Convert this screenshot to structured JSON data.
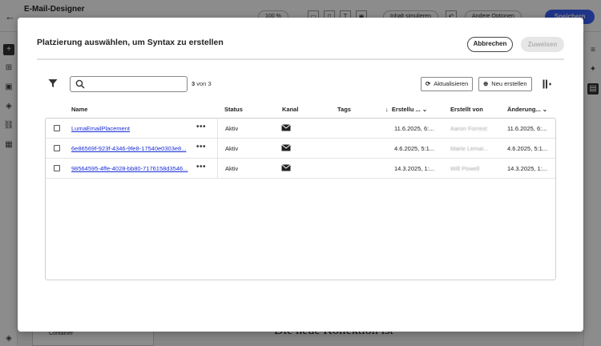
{
  "app": {
    "title": "E-Mail-Designer",
    "zoom": "100 %",
    "simulate": "Inhalt simulieren",
    "other_options": "Andere Optionen",
    "save": "Speichern",
    "canvas_text": "Die neue Kollektion ist",
    "container_label": "Container"
  },
  "modal": {
    "title": "Platzierung auswählen, um Syntax zu erstellen",
    "cancel": "Abbrechen",
    "assign": "Zuweisen",
    "search": {
      "value": "",
      "placeholder": ""
    },
    "count_current": "3",
    "count_suffix": "von 3",
    "refresh": "Aktualisieren",
    "create_new": "Neu erstellen",
    "columns": {
      "name": "Name",
      "status": "Status",
      "channel": "Kanal",
      "tags": "Tags",
      "created": "Erstellu ...",
      "created_by": "Erstellt von",
      "modified": "Änderung..."
    },
    "rows": [
      {
        "name": "LumaEmailPlacement",
        "status": "Aktiv",
        "created": "11.6.2025, 6:...",
        "created_by": "Aaron Forrest",
        "modified": "11.6.2025, 6:..."
      },
      {
        "name": "6e86569f-923f-4346-9fe8-17540e0303e8...",
        "status": "Aktiv",
        "created": "4.6.2025, 5:1...",
        "created_by": "Marie Lemai...",
        "modified": "4.6.2025, 5:1..."
      },
      {
        "name": "98564595-4ffe-4028-bb80-7176158d3546...",
        "status": "Aktiv",
        "created": "14.3.2025, 1:...",
        "created_by": "Will Powell",
        "modified": "14.3.2025, 1:..."
      }
    ]
  }
}
